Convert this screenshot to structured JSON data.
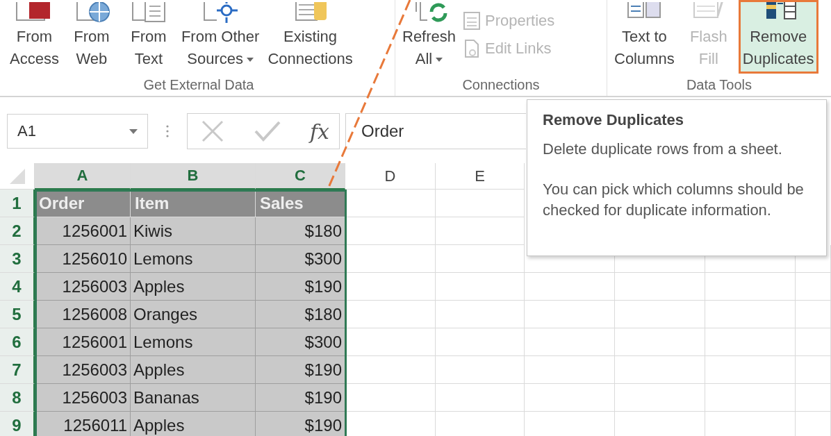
{
  "ribbon": {
    "groups": [
      {
        "label": "Get External Data",
        "buttons": [
          {
            "kind": "large",
            "label": "From\nAccess",
            "dropdown": false,
            "disabled": false,
            "highlighted": false
          },
          {
            "kind": "large",
            "label": "From\nWeb",
            "dropdown": false,
            "disabled": false,
            "highlighted": false
          },
          {
            "kind": "large",
            "label": "From\nText",
            "dropdown": false,
            "disabled": false,
            "highlighted": false
          },
          {
            "kind": "large",
            "label": "From Other\nSources",
            "dropdown": true,
            "disabled": false,
            "highlighted": false
          },
          {
            "kind": "large",
            "label": "Existing\nConnections",
            "dropdown": false,
            "disabled": false,
            "highlighted": false
          }
        ]
      },
      {
        "label": "Connections",
        "buttons": [
          {
            "kind": "large",
            "label": "Refresh\nAll",
            "dropdown": true,
            "disabled": false,
            "highlighted": false
          },
          {
            "kind": "small",
            "label": "Properties",
            "dropdown": false,
            "disabled": true,
            "highlighted": false
          },
          {
            "kind": "small",
            "label": "Edit Links",
            "dropdown": false,
            "disabled": true,
            "highlighted": false
          }
        ]
      },
      {
        "label": "Data Tools",
        "buttons": [
          {
            "kind": "large",
            "label": "Text to\nColumns",
            "dropdown": false,
            "disabled": false,
            "highlighted": false
          },
          {
            "kind": "large",
            "label": "Flash\nFill",
            "dropdown": false,
            "disabled": true,
            "highlighted": false
          },
          {
            "kind": "large",
            "label": "Remove\nDuplicates",
            "dropdown": false,
            "disabled": false,
            "highlighted": true
          }
        ]
      }
    ]
  },
  "formula_bar": {
    "name_box": "A1",
    "function_label": "fx",
    "formula": "Order"
  },
  "sheet": {
    "columns": [
      {
        "letter": "A",
        "selected": true
      },
      {
        "letter": "B",
        "selected": true
      },
      {
        "letter": "C",
        "selected": true
      },
      {
        "letter": "D",
        "selected": false
      },
      {
        "letter": "E",
        "selected": false
      }
    ],
    "rows": [
      {
        "kind": "header",
        "number": "1",
        "selected": true,
        "cells": [
          "Order",
          "Item",
          "Sales"
        ]
      },
      {
        "kind": "data",
        "number": "2",
        "selected": true,
        "cells": [
          "1256001",
          "Kiwis",
          "$180"
        ]
      },
      {
        "kind": "data",
        "number": "3",
        "selected": true,
        "cells": [
          "1256010",
          "Lemons",
          "$300"
        ]
      },
      {
        "kind": "data",
        "number": "4",
        "selected": true,
        "cells": [
          "1256003",
          "Apples",
          "$190"
        ]
      },
      {
        "kind": "data",
        "number": "5",
        "selected": true,
        "cells": [
          "1256008",
          "Oranges",
          "$180"
        ]
      },
      {
        "kind": "data",
        "number": "6",
        "selected": true,
        "cells": [
          "1256001",
          "Lemons",
          "$300"
        ]
      },
      {
        "kind": "data",
        "number": "7",
        "selected": true,
        "cells": [
          "1256003",
          "Apples",
          "$190"
        ]
      },
      {
        "kind": "data",
        "number": "8",
        "selected": true,
        "cells": [
          "1256003",
          "Bananas",
          "$190"
        ]
      },
      {
        "kind": "data",
        "number": "9",
        "selected": true,
        "cells": [
          "1256011",
          "Apples",
          "$190"
        ]
      }
    ]
  },
  "tooltip": {
    "title": "Remove Duplicates",
    "paragraphs": [
      "Delete duplicate rows from a sheet.",
      "You can pick which columns should be checked for duplicate information."
    ]
  }
}
